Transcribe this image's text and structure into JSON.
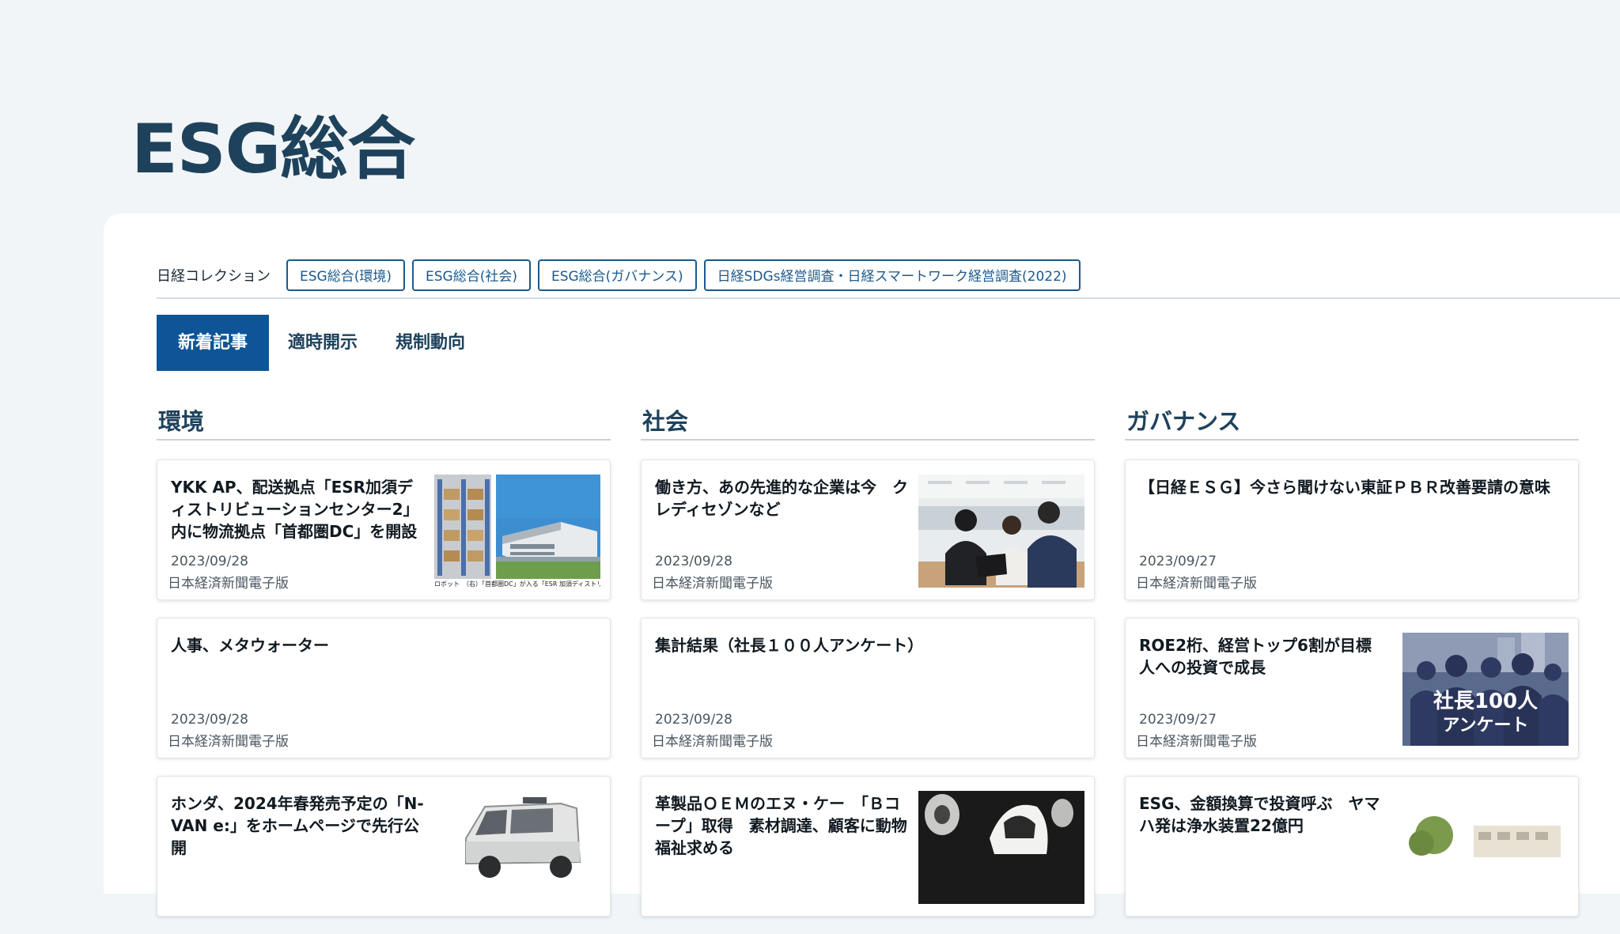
{
  "page": {
    "title": "ESG総合"
  },
  "collections": {
    "label": "日経コレクション",
    "chips": [
      "ESG総合(環境)",
      "ESG総合(社会)",
      "ESG総合(ガバナンス)",
      "日経SDGs経営調査・日経スマートワーク経営調査(2022)"
    ]
  },
  "tabs": [
    "新着記事",
    "適時開示",
    "規制動向"
  ],
  "columns": [
    {
      "title": "環境",
      "articles": [
        {
          "title": "YKK AP、配送拠点「ESR加須ディストリビューションセンター2」内に物流拠点「首都圏DC」を開設",
          "date": "2023/09/28",
          "source": "日本経済新聞電子版",
          "image": "warehouse-photo",
          "caption": "ロボット　（右）「首都圏DC」が入る「ESR 加須ディストリビュー"
        },
        {
          "title": "人事、メタウォーター",
          "date": "2023/09/28",
          "source": "日本経済新聞電子版"
        },
        {
          "title": "ホンダ、2024年春発売予定の「N-VAN e:」をホームページで先行公開",
          "date": "",
          "source": "",
          "image": "van-photo"
        }
      ]
    },
    {
      "title": "社会",
      "articles": [
        {
          "title": "働き方、あの先進的な企業は今　クレディセゾンなど",
          "date": "2023/09/28",
          "source": "日本経済新聞電子版",
          "image": "office-meeting-photo"
        },
        {
          "title": "集計結果（社長１００人アンケート）",
          "date": "2023/09/28",
          "source": "日本経済新聞電子版"
        },
        {
          "title": "革製品ＯＥＭのエヌ・ケー　「Ｂコープ」取得　素材調達、顧客に動物福祉求める",
          "date": "",
          "source": "",
          "image": "leather-goods-photo"
        }
      ]
    },
    {
      "title": "ガバナンス",
      "articles": [
        {
          "title": "【日経ＥＳＧ】今さら聞けない東証ＰＢＲ改善要請の意味",
          "date": "2023/09/27",
          "source": "日本経済新聞電子版"
        },
        {
          "title": "ROE2桁、経営トップ6割が目標　人への投資で成長",
          "date": "2023/09/27",
          "source": "日本経済新聞電子版",
          "image": "ceo-survey-graphic",
          "overlay": [
            "社長100人",
            "アンケート"
          ]
        },
        {
          "title": "ESG、金額換算で投資呼ぶ　ヤマハ発は浄水装置22億円",
          "date": "",
          "source": "",
          "image": "water-plant-photo"
        }
      ]
    }
  ]
}
